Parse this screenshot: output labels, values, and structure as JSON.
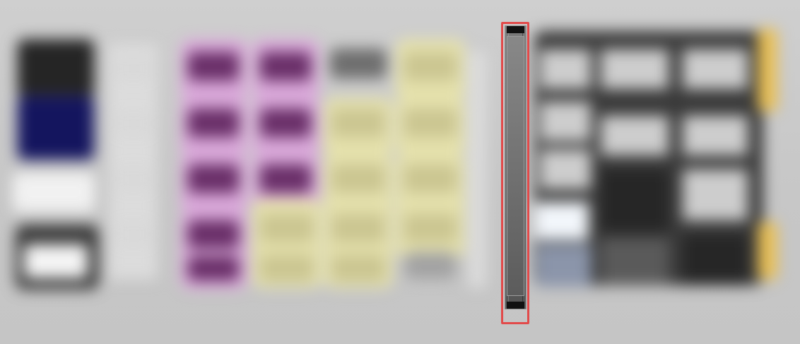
{
  "app": {
    "theme": "blurred-grid-ui"
  },
  "colors": {
    "background": "#c9c9c9",
    "left_black": "#252525",
    "left_navy": "#14155e",
    "left_white": "#f1f1f1",
    "violet": "#6a2f69",
    "violet_bg": "#d8a6d8",
    "khaki": "#cbc691",
    "khaki_bg": "#e4e0aa",
    "gray_pad": "#6e6e6e",
    "silver_pad": "#a2a2a2",
    "right_dark": "#3a3a3a",
    "right_mid": "#5a5a5a",
    "right_light": "#cdcdcd",
    "right_near_white": "#f2f6fb",
    "right_blue": "#8b95aa",
    "right_black": "#262626",
    "gold": "#e8bf55",
    "highlight": "#e24a4a"
  },
  "icons": {
    "scrollbar": "vertical-scrollbar-icon",
    "highlight": "selection-frame-icon"
  }
}
